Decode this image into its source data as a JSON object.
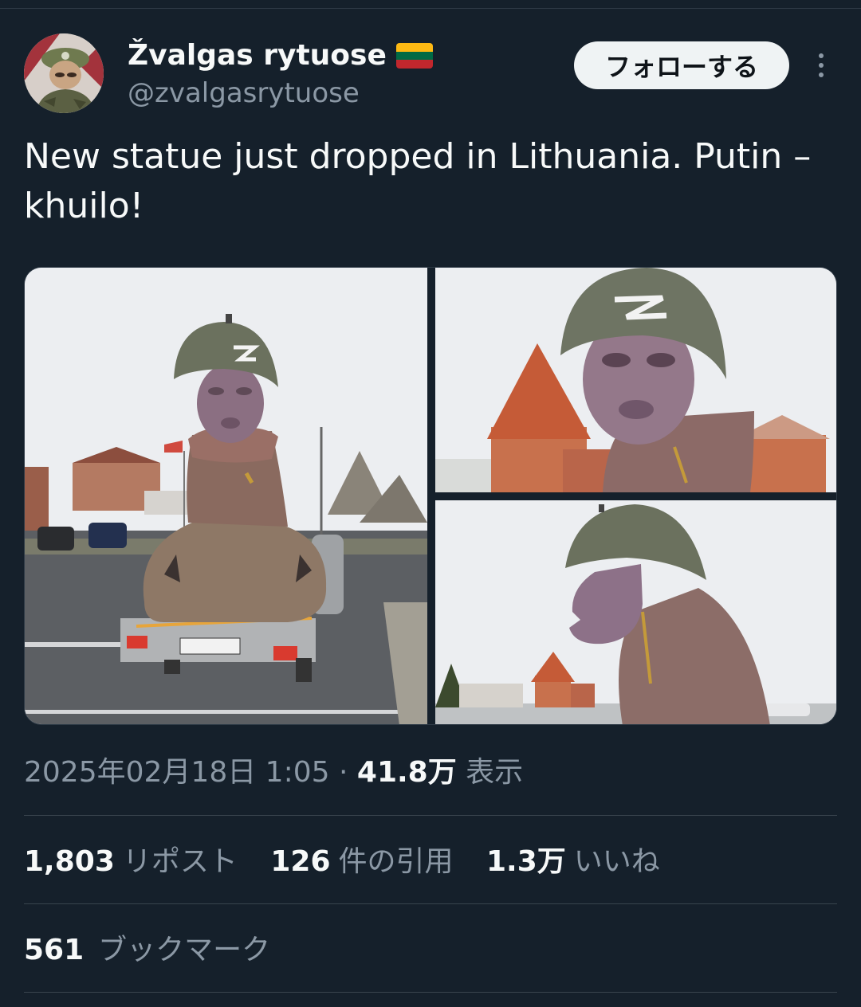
{
  "user": {
    "display_name": "Žvalgas rytuose",
    "handle": "@zvalgasrytuose",
    "flag_icon": "lithuania-flag-icon",
    "flag_colors": [
      "#fdb913",
      "#006a44",
      "#c1272d"
    ]
  },
  "actions": {
    "follow_label": "フォローする",
    "more_icon": "more-options-icon"
  },
  "tweet": {
    "text": "New statue just dropped in Lithuania. Putin – khuilo!"
  },
  "media": {
    "count": 3
  },
  "meta": {
    "timestamp": "2025年02月18日 1:05",
    "separator": "·",
    "views_count": "41.8万",
    "views_label": "表示"
  },
  "stats": {
    "reposts_count": "1,803",
    "reposts_label": "リポスト",
    "quotes_count": "126",
    "quotes_label": "件の引用",
    "likes_count": "1.3万",
    "likes_label": "いいね",
    "bookmarks_count": "561",
    "bookmarks_label": "ブックマーク"
  },
  "colors": {
    "background": "#15202b",
    "secondary_text": "#8b98a5",
    "follow_button_bg": "#eff3f4"
  }
}
